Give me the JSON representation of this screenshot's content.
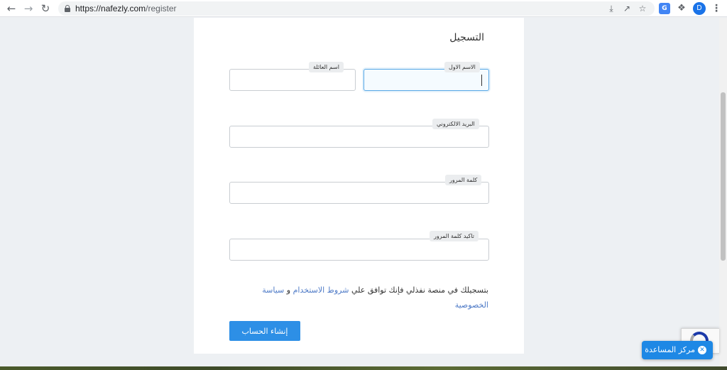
{
  "browser": {
    "url_host": "https://nafezly.com",
    "url_path": "/register",
    "avatar_initial": "D",
    "icons": [
      "back-icon",
      "forward-icon",
      "reload-icon",
      "lock-icon",
      "download-icon",
      "share-icon",
      "star-icon",
      "translate-icon",
      "puzzle-icon",
      "menu-icon"
    ]
  },
  "form": {
    "title": "التسجيل",
    "fields": {
      "first_name": {
        "label": "الاسم الاول",
        "value": ""
      },
      "last_name": {
        "label": "اسم العائلة",
        "value": ""
      },
      "email": {
        "label": "البريد الالكتروني",
        "value": ""
      },
      "password": {
        "label": "كلمة المرور",
        "value": ""
      },
      "password_confirm": {
        "label": "تاكيد كلمة المرور",
        "value": ""
      }
    },
    "terms": {
      "text_before": "بتسجيلك في منصة نفذلي فإنك توافق علي ",
      "terms_link": "شروط الاستخدام",
      "conjunction": " و ",
      "privacy_link": "سياسة الخصوصية"
    },
    "submit_label": "إنشاء الحساب"
  },
  "help": {
    "label": "مركز المساعدة",
    "icon": "close-circle-icon"
  },
  "colors": {
    "page_bg": "#edf0f3",
    "card_bg": "#ffffff",
    "primary": "#2d8fe6",
    "link": "#4f7bc7",
    "focus_border": "#5aa9e6"
  }
}
